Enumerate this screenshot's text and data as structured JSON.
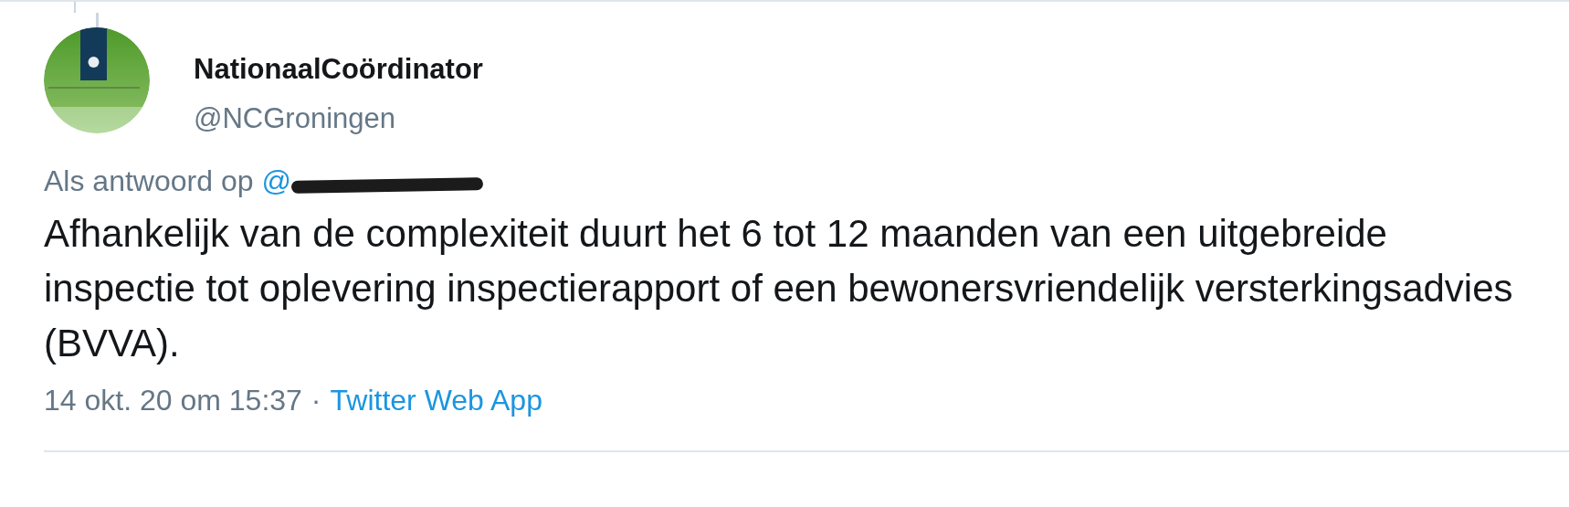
{
  "tweet": {
    "author": {
      "name": "NationaalCoördinator",
      "handle": "@NCGroningen"
    },
    "reply_label": "Als antwoord op",
    "reply_to": "@",
    "text": "Afhankelijk van de complexiteit duurt het 6 tot 12 maanden van een uitgebreide inspectie tot oplevering inspectierapport of een bewonersvriendelijk versterkingsadvies (BVVA).",
    "timestamp": "14 okt. 20 om 15:37",
    "separator": "·",
    "source": "Twitter Web App"
  }
}
